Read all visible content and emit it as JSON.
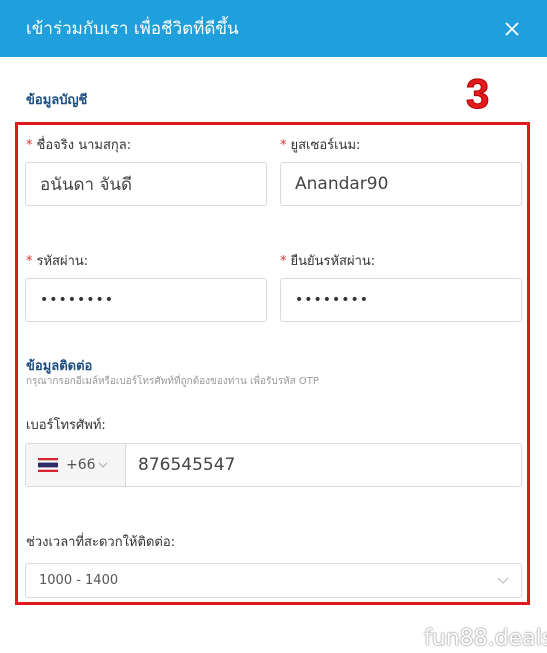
{
  "header": {
    "title": "เข้าร่วมกับเรา เพื่อชีวิตที่ดีขึ้น"
  },
  "account_section": {
    "title": "ข้อมูลบัญชี"
  },
  "step_number": "3",
  "fields": {
    "full_name": {
      "label": "ชื่อจริง นามสกุล:",
      "value": "อนันดา จันดี"
    },
    "username": {
      "label": "ยูสเซอร์เนม:",
      "value": "Anandar90"
    },
    "password": {
      "label": "รหัสผ่าน:",
      "value": "••••••••"
    },
    "confirm_password": {
      "label": "ยืนยันรหัสผ่าน:",
      "value": "••••••••"
    }
  },
  "required_mark": "*",
  "contact_section": {
    "title": "ข้อมูลติดต่อ",
    "subtitle": "กรุณากรอกอีเมล์หรือเบอร์โทรศัพท์ที่ถูกต้องของท่าน เพื่อรับรหัส OTP"
  },
  "phone": {
    "label": "เบอร์โทรศัพท์:",
    "country_code": "+66",
    "value": "876545547",
    "flag_icon": "thailand-flag-icon"
  },
  "contact_time": {
    "label": "ช่วงเวลาที่สะดวกให้ติดต่อ:",
    "selected": "1000 - 1400"
  },
  "watermark": "fun88.deals",
  "colors": {
    "header_bg": "#1f9fdc",
    "section_title": "#1c4f80",
    "required": "#e0312b",
    "highlight_box": "#e3171e"
  }
}
